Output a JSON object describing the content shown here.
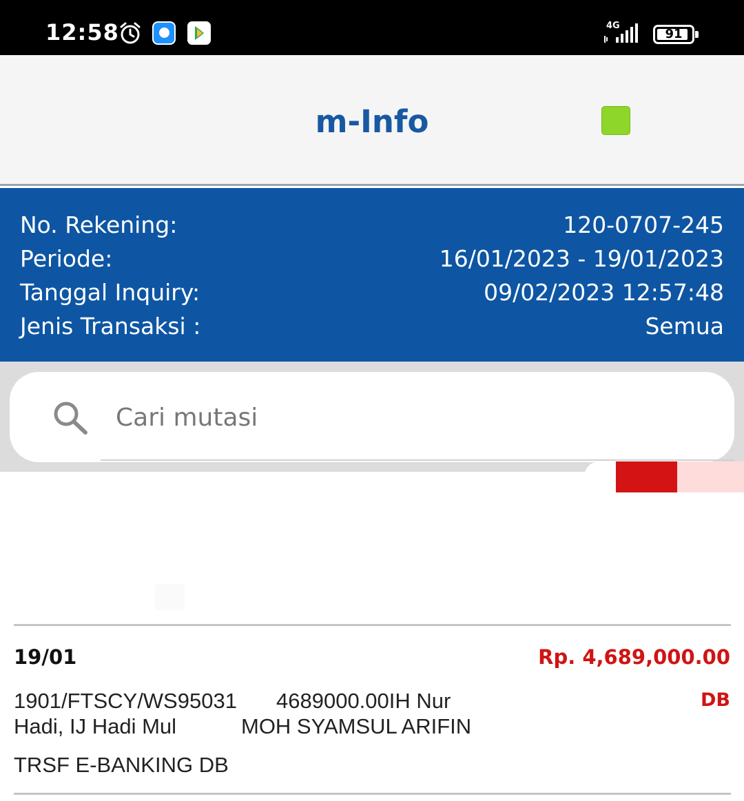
{
  "status_bar": {
    "time": "12:58",
    "network": "4G",
    "battery_text": "91",
    "battery_level": 0.91,
    "icons": [
      "alarm-icon",
      "messaging-app-icon",
      "play-store-icon",
      "signal-icon",
      "battery-icon"
    ]
  },
  "header": {
    "title": "m-Info",
    "indicator_color": "#8fd62a"
  },
  "info": {
    "rows": [
      {
        "label": "No. Rekening:",
        "value": "120-0707-245"
      },
      {
        "label": "Periode:",
        "value": "16/01/2023 - 19/01/2023"
      },
      {
        "label": "Tanggal Inquiry:",
        "value": "09/02/2023 12:57:48"
      },
      {
        "label": "Jenis Transaksi :",
        "value": "Semua"
      }
    ]
  },
  "search": {
    "placeholder": "Cari mutasi",
    "value": ""
  },
  "transactions": [
    {
      "date": "19/01",
      "amount": "Rp. 4,689,000.00",
      "type": "DB",
      "line1_left": "1901/FTSCY/WS95031",
      "line1_right": "4689000.00IH Nur",
      "line2_left": "Hadi, IJ Hadi Mul",
      "line2_right": "MOH SYAMSUL ARIFIN",
      "description": "TRSF E-BANKING DB"
    }
  ],
  "colors": {
    "primary": "#0e56a3",
    "title": "#1759a3",
    "debit": "#d01414"
  }
}
